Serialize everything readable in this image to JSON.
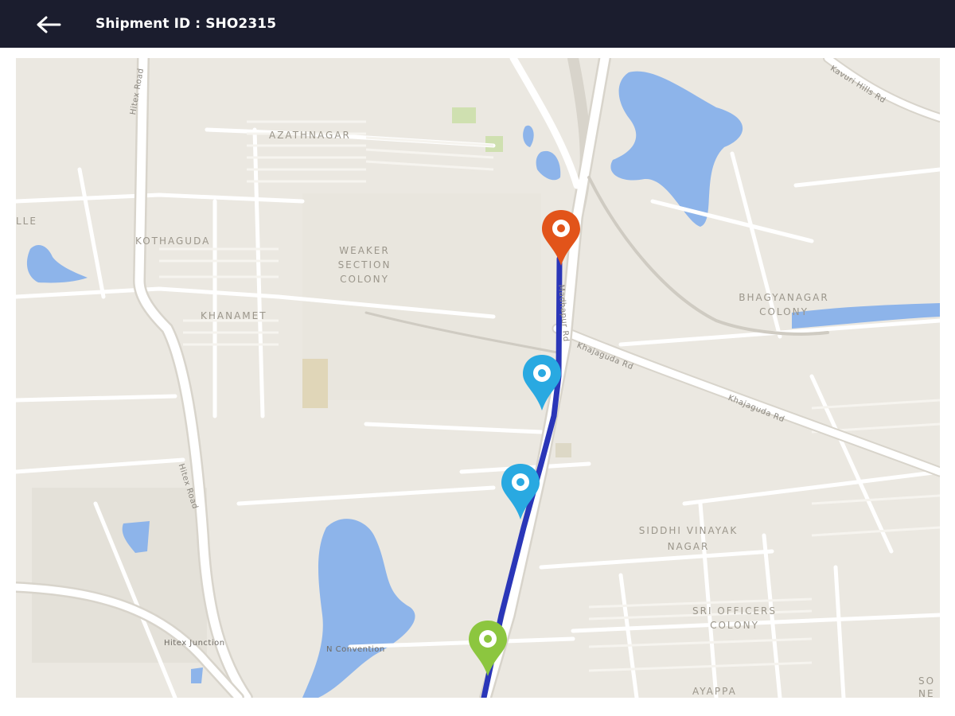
{
  "header": {
    "back_icon": "arrow-left-icon",
    "title": "Shipment ID : SHO2315",
    "background": "#1b1d2e"
  },
  "map": {
    "area_labels": {
      "azathnagar": "AZATHNAGAR",
      "kothaguda": "KOTHAGUDA",
      "weaker_section_colony": "WEAKER SECTION COLONY",
      "khanamet": "KHANAMET",
      "bhagyanagar_colony": "BHAGYANAGAR COLONY",
      "siddhi_vinayak_nagar": "SIDDHI VINAYAK NAGAR",
      "sri_officers_colony": "SRI OFFICERS COLONY",
      "ayappa": "AYAPPA",
      "left_edge": "LLE",
      "right_edge": "SO NE"
    },
    "road_labels": {
      "hitex_road_top": "Hitex Road",
      "hitex_road_lower": "Hitex Road",
      "kavuri_hills_rd": "Kavuri Hills Rd",
      "khajaguda_rd_1": "Khajaguda Rd",
      "khajaguda_rd_2": "Khajaguda Rd",
      "main_road_vertical": "Madhapur Rd"
    },
    "place_labels": {
      "hitex_junction": "Hitex Junction",
      "n_convention": "N Convention"
    },
    "route_color": "#2a36b8",
    "markers": [
      {
        "name": "destination",
        "icon": "location-pin-icon",
        "color": "#e2541a"
      },
      {
        "name": "checkpoint-1",
        "icon": "location-pin-icon",
        "color": "#29a9e1"
      },
      {
        "name": "checkpoint-2",
        "icon": "location-pin-icon",
        "color": "#29a9e1"
      },
      {
        "name": "origin",
        "icon": "location-pin-icon",
        "color": "#8cc63f"
      }
    ]
  }
}
